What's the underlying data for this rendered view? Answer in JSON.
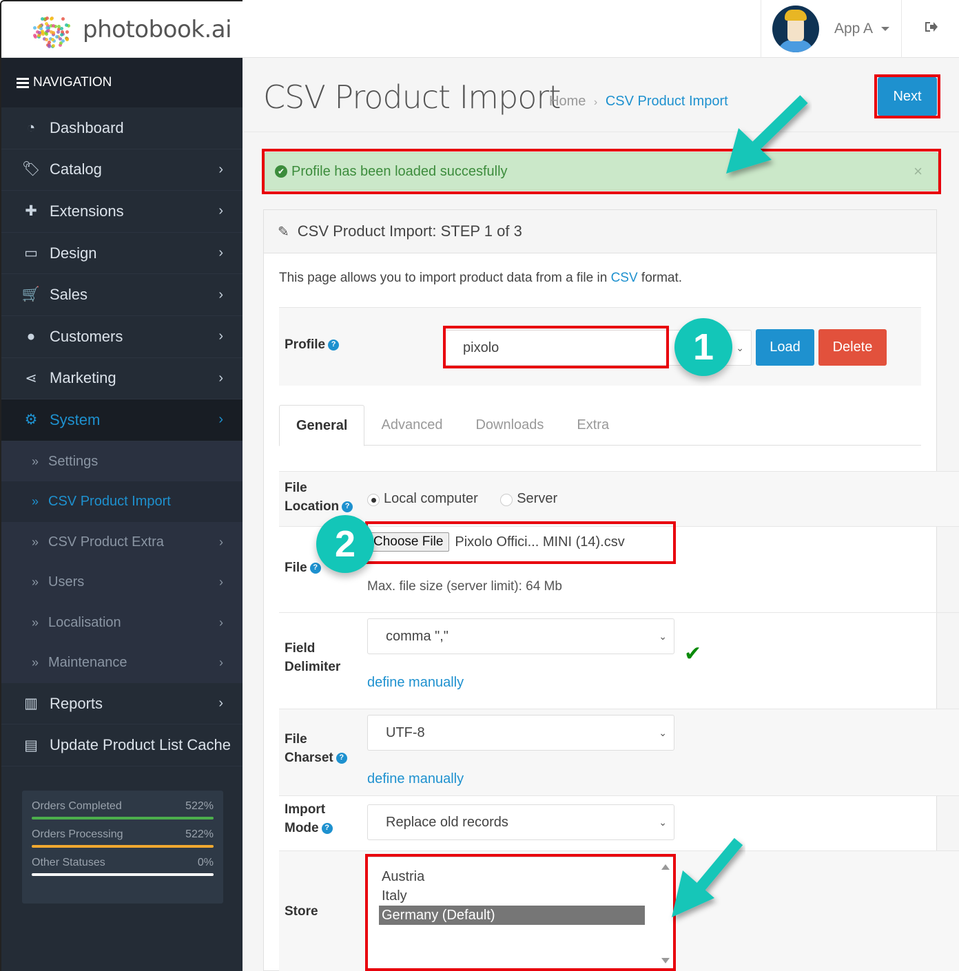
{
  "header": {
    "brand": "photobook.ai",
    "user_name": "App A"
  },
  "sidebar": {
    "nav_title": "NAVIGATION",
    "items": [
      {
        "label": "Dashboard",
        "icon": "dashboard-icon",
        "glyph": "◔",
        "has_children": false
      },
      {
        "label": "Catalog",
        "icon": "tag-icon",
        "glyph": "🏷",
        "has_children": true
      },
      {
        "label": "Extensions",
        "icon": "puzzle-icon",
        "glyph": "✚",
        "has_children": true
      },
      {
        "label": "Design",
        "icon": "monitor-icon",
        "glyph": "▭",
        "has_children": true
      },
      {
        "label": "Sales",
        "icon": "cart-icon",
        "glyph": "🛒",
        "has_children": true
      },
      {
        "label": "Customers",
        "icon": "user-icon",
        "glyph": "●",
        "has_children": true
      },
      {
        "label": "Marketing",
        "icon": "share-icon",
        "glyph": "⋖",
        "has_children": true
      },
      {
        "label": "System",
        "icon": "gear-icon",
        "glyph": "⚙",
        "has_children": true,
        "active": true
      }
    ],
    "sub_items": [
      {
        "label": "Settings",
        "has_children": false
      },
      {
        "label": "CSV Product Import",
        "has_children": false,
        "current": true
      },
      {
        "label": "CSV Product Extra",
        "has_children": true
      },
      {
        "label": "Users",
        "has_children": true
      },
      {
        "label": "Localisation",
        "has_children": true
      },
      {
        "label": "Maintenance",
        "has_children": true
      }
    ],
    "bottom_items": [
      {
        "label": "Reports",
        "icon": "bar-chart-icon",
        "glyph": "▥",
        "has_children": true
      },
      {
        "label": "Update Product List Cache",
        "icon": "book-icon",
        "glyph": "▤",
        "has_children": false
      }
    ],
    "stats": [
      {
        "label": "Orders Completed",
        "value": "522%",
        "color": "#4cae4c"
      },
      {
        "label": "Orders Processing",
        "value": "522%",
        "color": "#f0a830"
      },
      {
        "label": "Other Statuses",
        "value": "0%",
        "color": "#ffffff"
      }
    ]
  },
  "page": {
    "title": "CSV Product Import",
    "breadcrumb": [
      {
        "label": "Home"
      },
      {
        "label": "CSV Product Import"
      }
    ],
    "next_label": "Next",
    "alert": {
      "message": "Profile has been loaded succesfully",
      "close": "×"
    }
  },
  "panel": {
    "heading": "CSV Product Import: STEP 1 of 3",
    "intro_before": "This page allows you to import product data from a file in ",
    "intro_link": "CSV",
    "intro_after": " format.",
    "profile": {
      "label": "Profile",
      "value": "pixolo",
      "load_label": "Load",
      "delete_label": "Delete"
    },
    "tabs": [
      {
        "label": "General",
        "active": true
      },
      {
        "label": "Advanced"
      },
      {
        "label": "Downloads"
      },
      {
        "label": "Extra"
      }
    ],
    "file_location": {
      "label_line1": "File",
      "label_line2": "Location",
      "options": [
        {
          "label": "Local computer",
          "checked": true
        },
        {
          "label": "Server",
          "checked": false
        }
      ]
    },
    "file": {
      "label": "File",
      "button_label": "Choose File",
      "file_name": "Pixolo Offici... MINI (14).csv",
      "hint": "Max. file size (server limit): 64 Mb"
    },
    "field_delimiter": {
      "label_line1": "Field",
      "label_line2": "Delimiter",
      "value": "comma \",\"",
      "link": "define manually"
    },
    "file_charset": {
      "label_line1": "File",
      "label_line2": "Charset",
      "value": "UTF-8",
      "link": "define manually"
    },
    "import_mode": {
      "label_line1": "Import",
      "label_line2": "Mode",
      "value": "Replace old records"
    },
    "store": {
      "label": "Store",
      "options": [
        {
          "label": "Austria",
          "selected": false
        },
        {
          "label": "Italy",
          "selected": false
        },
        {
          "label": "Germany (Default)",
          "selected": true
        }
      ]
    }
  },
  "annotations": {
    "badge_1": "1",
    "badge_2": "2",
    "highlight_color": "#e8000b",
    "arrow_color": "#13c6b8"
  }
}
